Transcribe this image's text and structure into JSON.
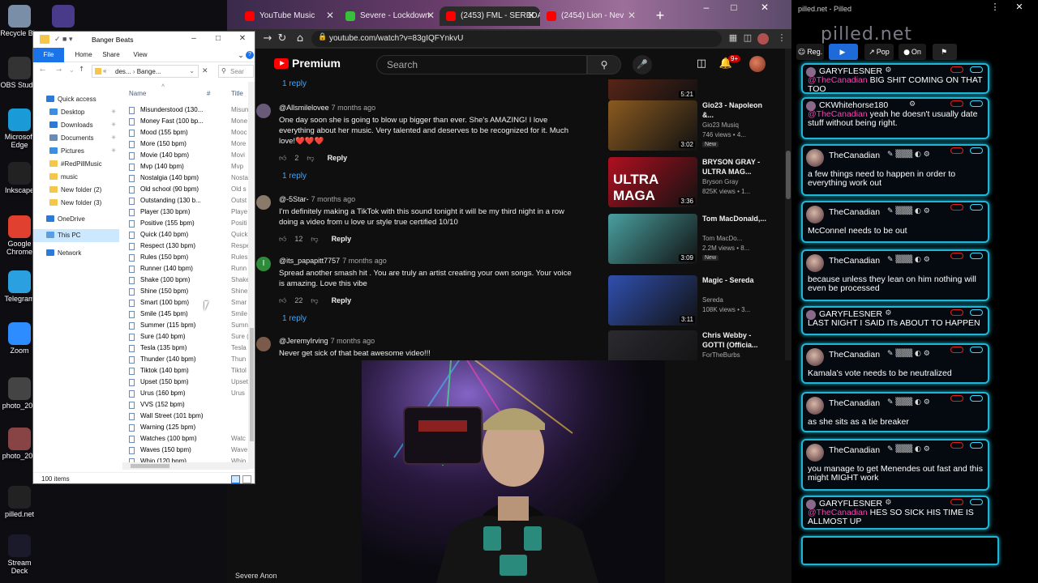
{
  "desktop": {
    "icons": [
      {
        "label": "Recycle Bin",
        "icon": "recycle-bin-icon",
        "color": "#7a8ea8"
      },
      {
        "label": "",
        "icon": "app-icon",
        "color": "#4a3a8a"
      },
      {
        "label": "OBS Studio",
        "icon": "obs-icon",
        "color": "#333333"
      },
      {
        "label": "Microsoft Edge",
        "icon": "edge-icon",
        "color": "#1a9bd8"
      },
      {
        "label": "Inkscape",
        "icon": "inkscape-icon",
        "color": "#222222"
      },
      {
        "label": "Google Chrome",
        "icon": "chrome-icon",
        "color": "#e04030"
      },
      {
        "label": "Telegram",
        "icon": "telegram-icon",
        "color": "#2aa0e0"
      },
      {
        "label": "Zoom",
        "icon": "zoom-icon",
        "color": "#2d8cff"
      },
      {
        "label": "photo_202",
        "icon": "photo-icon",
        "color": "#444444"
      },
      {
        "label": "photo_202",
        "icon": "photo-icon",
        "color": "#884444"
      },
      {
        "label": "pilled.net",
        "icon": "pilled-icon",
        "color": "#222222"
      },
      {
        "label": "Stream Deck",
        "icon": "stream-deck-icon",
        "color": "#1a1a2a"
      }
    ]
  },
  "explorer": {
    "title": "Banger Beats",
    "ribbon": [
      "File",
      "Home",
      "Share",
      "View"
    ],
    "address_parts": [
      "des...",
      "Bange..."
    ],
    "search_placeholder": "Sear",
    "nav": [
      {
        "label": "Quick access",
        "color": "#2d7ad6",
        "pin": false,
        "indent": 0
      },
      {
        "label": "Desktop",
        "color": "#3b8ee0",
        "pin": true,
        "indent": 1
      },
      {
        "label": "Downloads",
        "color": "#2d7ad6",
        "pin": true,
        "indent": 1
      },
      {
        "label": "Documents",
        "color": "#6a8bb8",
        "pin": true,
        "indent": 1
      },
      {
        "label": "Pictures",
        "color": "#3b8ee0",
        "pin": true,
        "indent": 1
      },
      {
        "label": "#RedPillMusic",
        "color": "#f4c64a",
        "pin": false,
        "indent": 1
      },
      {
        "label": "music",
        "color": "#f4c64a",
        "pin": false,
        "indent": 1
      },
      {
        "label": "New folder (2)",
        "color": "#f4c64a",
        "pin": false,
        "indent": 1
      },
      {
        "label": "New folder (3)",
        "color": "#f4c64a",
        "pin": false,
        "indent": 1
      },
      {
        "label": "OneDrive",
        "color": "#2d7ad6",
        "pin": false,
        "indent": 0
      },
      {
        "label": "This PC",
        "color": "#5aa0e0",
        "pin": false,
        "indent": 0,
        "selected": true
      },
      {
        "label": "Network",
        "color": "#2d7ad6",
        "pin": false,
        "indent": 0
      }
    ],
    "columns": {
      "name": "Name",
      "num": "#",
      "title": "Title"
    },
    "files": [
      {
        "name": "Misunderstood (130...",
        "title": "Misun"
      },
      {
        "name": "Money Fast (100 bp...",
        "title": "Mone"
      },
      {
        "name": "Mood (155 bpm)",
        "title": "Mooc"
      },
      {
        "name": "More (150 bpm)",
        "title": "More"
      },
      {
        "name": "Movie (140 bpm)",
        "title": "Movi"
      },
      {
        "name": "Mvp (140 bpm)",
        "title": "Mvp"
      },
      {
        "name": "Nostalgia (140 bpm)",
        "title": "Nosta"
      },
      {
        "name": "Old school (90 bpm)",
        "title": "Old s"
      },
      {
        "name": "Outstanding (130 b...",
        "title": "Outst"
      },
      {
        "name": "Player (130 bpm)",
        "title": "Playe"
      },
      {
        "name": "Positive (155 bpm)",
        "title": "Positi"
      },
      {
        "name": "Quick (140 bpm)",
        "title": "Quick"
      },
      {
        "name": "Respect (130 bpm)",
        "title": "Respe"
      },
      {
        "name": "Rules (150 bpm)",
        "title": "Rules"
      },
      {
        "name": "Runner (140 bpm)",
        "title": "Runn"
      },
      {
        "name": "Shake (100 bpm)",
        "title": "Shake"
      },
      {
        "name": "Shine (150 bpm)",
        "title": "Shine"
      },
      {
        "name": "Smart (100 bpm)",
        "title": "Smar"
      },
      {
        "name": "Smile (145 bpm)",
        "title": "Smile"
      },
      {
        "name": "Summer (115 bpm)",
        "title": "Sumn"
      },
      {
        "name": "Sure (140 bpm)",
        "title": "Sure ("
      },
      {
        "name": "Tesla (135 bpm)",
        "title": "Tesla"
      },
      {
        "name": "Thunder (140 bpm)",
        "title": "Thun"
      },
      {
        "name": "Tiktok (140 bpm)",
        "title": "Tiktol"
      },
      {
        "name": "Upset (150 bpm)",
        "title": "Upset"
      },
      {
        "name": "Urus (160 bpm)",
        "title": "Urus"
      },
      {
        "name": "VVS (152 bpm)",
        "title": ""
      },
      {
        "name": "Wall Street (101 bpm)",
        "title": ""
      },
      {
        "name": "Warning (125 bpm)",
        "title": ""
      },
      {
        "name": "Watches (100 bpm)",
        "title": "Watc"
      },
      {
        "name": "Waves (150 bpm)",
        "title": "Wave"
      },
      {
        "name": "Whip (120 bpm)",
        "title": "Whip"
      }
    ],
    "status": "100 items"
  },
  "browser": {
    "tabs": [
      {
        "label": "YouTube Music",
        "color": "#ff0000",
        "active": false
      },
      {
        "label": "Severe - Lockdown",
        "color": "#38c038",
        "active": false
      },
      {
        "label": "(2453) FML - SEREDA (",
        "color": "#ff0000",
        "active": true
      },
      {
        "label": "(2454) Lion - Nev",
        "color": "#ff0000",
        "active": false
      }
    ],
    "url": "youtube.com/watch?v=83gIQFYnkvU",
    "youtube": {
      "logo": "Premium",
      "search_placeholder": "Search",
      "notif_count": "9+",
      "reply_label": "Reply",
      "comments": [
        {
          "author": "@Allsmilelovee",
          "time": "7 months ago",
          "text": "One day soon she is going to blow up bigger than ever. She's AMAZING! I love everything about her music. Very talented and deserves to be recognized for it. Much love!❤️❤️❤️",
          "likes": "2",
          "replies": "1 reply",
          "avatar_color": "#6a5a7a"
        },
        {
          "author": "@-5Star-",
          "time": "7 months ago",
          "text": "I'm definitely making a TikTok with this sound tonight it will be my third night in a row doing a video from u love ur style true certified 10/10",
          "likes": "12",
          "replies": "",
          "avatar_color": "#8a7a6a"
        },
        {
          "author": "@its_papapitt7757",
          "time": "7 months ago",
          "text": "Spread another smash hit . You are truly an artist creating your own songs. Your voice is amazing. Love this vibe",
          "likes": "22",
          "replies": "1 reply",
          "avatar_color": "#2e8b3a",
          "initial": "I"
        },
        {
          "author": "@JeremyIrving",
          "time": "7 months ago",
          "text": "Never get sick of that beat awesome video!!!",
          "likes": "",
          "replies": "",
          "avatar_color": "#7a5a4a"
        }
      ],
      "top_reply": "1 reply",
      "recommendations": [
        {
          "title": "",
          "channel": "",
          "views": "",
          "duration": "5:21",
          "thumb": "#6a2a18",
          "new": false
        },
        {
          "title": "Gio23 - Napoleon &...",
          "channel": "Gio23 Musiq",
          "views": "746 views • 4...",
          "duration": "3:02",
          "thumb": "#8a5a20",
          "new": true
        },
        {
          "title": "BRYSON GRAY - ULTRA MAG...",
          "channel": "Bryson Gray",
          "views": "825K views • 1...",
          "duration": "3:36",
          "thumb": "#b01020",
          "new": false,
          "overlay": "ULTRA MAGA"
        },
        {
          "title": "Tom MacDonald,...",
          "channel": "Tom MacDo...",
          "views": "2.2M views • 8...",
          "duration": "3:09",
          "thumb": "#4aa0a0",
          "new": true
        },
        {
          "title": "Magic - Sereda",
          "channel": "Sereda",
          "views": "108K views • 3...",
          "duration": "3:11",
          "thumb": "#3050b0",
          "new": false
        },
        {
          "title": "Chris Webby - GOTTI (Officia...",
          "channel": "ForTheBurbs",
          "views": "",
          "duration": "",
          "thumb": "#2a2a30",
          "new": false
        }
      ]
    }
  },
  "webcam": {
    "label": "Severe Anon"
  },
  "chat": {
    "title": "pilled.net - Pilled",
    "logo": "pilled.net",
    "tools": [
      {
        "label": "Reg.",
        "icon": "users-icon"
      },
      {
        "label": "",
        "icon": "live-icon"
      },
      {
        "label": "Pop",
        "icon": "popout-icon"
      },
      {
        "label": "On",
        "icon": "mic-icon"
      },
      {
        "label": "",
        "icon": "filter-icon"
      }
    ],
    "messages": [
      {
        "user": "GARYFLESNER",
        "mention": "@TheCanadian",
        "text": "BIG SHIT COMING ON THAT TOO",
        "avatar": false
      },
      {
        "user": "CKWhitehorse180",
        "mention": "@TheCanadian",
        "text": "yeah he doesn't usually date stuff without being right.",
        "avatar": false
      },
      {
        "user": "TheCanadian",
        "mention": "",
        "text": "a few things need to happen in order to everything work out",
        "avatar": true
      },
      {
        "user": "TheCanadian",
        "mention": "",
        "text": "McConnel needs to be out",
        "avatar": true
      },
      {
        "user": "TheCanadian",
        "mention": "",
        "text": "because unless they lean on him nothing will even be processed",
        "avatar": true
      },
      {
        "user": "GARYFLESNER",
        "mention": "",
        "text": "LAST NIGHT I SAID ITs ABOUT TO HAPPEN",
        "avatar": false
      },
      {
        "user": "TheCanadian",
        "mention": "",
        "text": "Kamala's vote needs to be neutralized",
        "avatar": true
      },
      {
        "user": "TheCanadian",
        "mention": "",
        "text": "as she sits as a tie breaker",
        "avatar": true
      },
      {
        "user": "TheCanadian",
        "mention": "",
        "text": "you manage to get Menendes out fast and this might MIGHT work",
        "avatar": true
      },
      {
        "user": "GARYFLESNER",
        "mention": "@TheCanadian",
        "text": "HES SO SICK HIS TIME IS ALLMOST UP",
        "avatar": false
      }
    ],
    "accent": "#1fb6d6",
    "mention_color": "#ff3fb4"
  }
}
